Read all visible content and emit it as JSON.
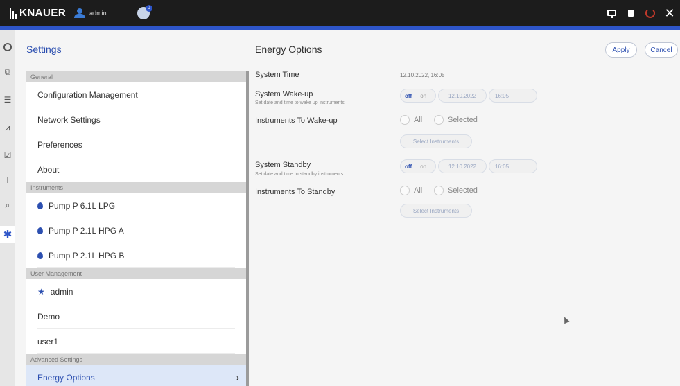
{
  "topbar": {
    "brand": "KNAUER",
    "user": "admin",
    "notification_count": "0",
    "icons": [
      "logo-bars-icon",
      "user-icon",
      "instrument-status-icon",
      "monitor-icon",
      "lock-icon",
      "power-icon",
      "close-icon"
    ],
    "colors": {
      "bar": "#1c1c1c",
      "accent_strip": "#2e55c8"
    }
  },
  "rail": {
    "icons": [
      "run-circle-icon",
      "instruments-network-icon",
      "method-list-icon",
      "chromatogram-icon",
      "checklist-icon",
      "text-cursor-icon",
      "search-report-icon",
      "settings-gear-icon"
    ],
    "active": "settings-gear-icon"
  },
  "header": {
    "left_title": "Settings",
    "right_title": "Energy Options",
    "apply_label": "Apply",
    "cancel_label": "Cancel"
  },
  "settings_list": {
    "sections": [
      {
        "title": "General",
        "items": [
          "Configuration Management",
          "Network Settings",
          "Preferences",
          "About"
        ]
      },
      {
        "title": "Instruments",
        "items": [
          "Pump P 6.1L LPG",
          "Pump P 2.1L HPG A",
          "Pump P 2.1L HPG B"
        ]
      },
      {
        "title": "User Management",
        "items": [
          "admin",
          "Demo",
          "user1"
        ]
      },
      {
        "title": "Advanced Settings",
        "items": [
          "Energy Options"
        ]
      }
    ],
    "selected": "Energy Options",
    "chevron": "›"
  },
  "energy": {
    "system_time_label": "System Time",
    "system_time_value": "12.10.2022, 16:05",
    "wake_label": "System Wake-up",
    "wake_sub": "Set date and time to wake up instruments",
    "wake_off": "off",
    "wake_on": "on",
    "wake_date": "12.10.2022",
    "wake_time": "16:05",
    "wake_instruments_label": "Instruments To Wake-up",
    "radio_all": "All",
    "radio_selected": "Selected",
    "select_instruments": "Select Instruments",
    "standby_label": "System Standby",
    "standby_sub": "Set date and time to standby instruments",
    "standby_off": "off",
    "standby_on": "on",
    "standby_date": "12.10.2022",
    "standby_time": "16:05",
    "standby_instruments_label": "Instruments To Standby",
    "radio_all_2": "All",
    "radio_selected_2": "Selected",
    "select_instruments_2": "Select Instruments"
  }
}
